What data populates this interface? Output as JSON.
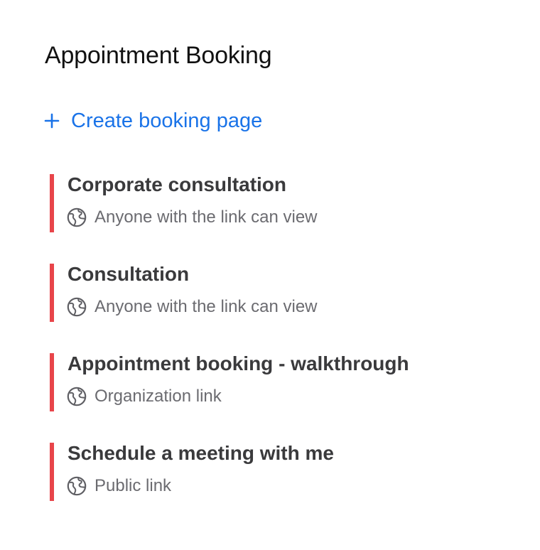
{
  "page": {
    "title": "Appointment Booking"
  },
  "create": {
    "icon": "plus-icon",
    "label": "Create booking page",
    "color": "#1a73e8"
  },
  "accent_color": "#e8454a",
  "booking_pages": [
    {
      "name": "Corporate consultation",
      "access": "Anyone with the link can view",
      "icon": "globe-icon"
    },
    {
      "name": "Consultation",
      "access": "Anyone with the link can view",
      "icon": "globe-icon"
    },
    {
      "name": "Appointment booking - walkthrough",
      "access": "Organization link",
      "icon": "globe-icon"
    },
    {
      "name": "Schedule a meeting with me",
      "access": "Public link",
      "icon": "globe-icon"
    }
  ]
}
